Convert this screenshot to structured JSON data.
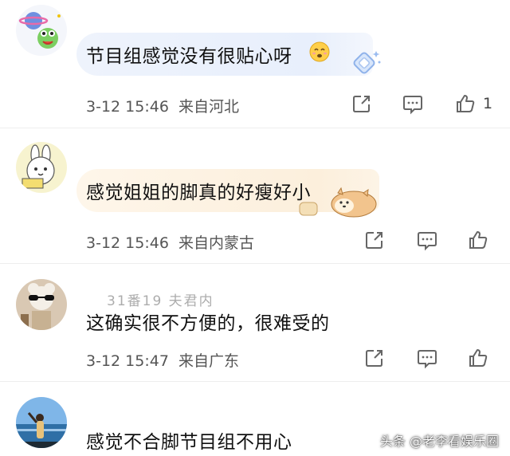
{
  "comments": [
    {
      "text": "节目组感觉没有很贴心呀",
      "time": "3-12 15:46",
      "location": "来自河北",
      "likes": "1"
    },
    {
      "text": "感觉姐姐的脚真的好瘦好小",
      "time": "3-12 15:46",
      "location": "来自内蒙古",
      "likes": ""
    },
    {
      "text": "这确实很不方便的，很难受的",
      "time": "3-12 15:47",
      "location": "来自广东",
      "likes": "",
      "faded_overlay": "31番19 夫君内"
    },
    {
      "text": "感觉不合脚节目组不用心"
    }
  ],
  "watermark": "头条 @老李看娱乐圈",
  "icons": [
    "share-icon",
    "comment-icon",
    "like-icon",
    "emoji-icon",
    "sticker-icon"
  ],
  "colors": {
    "bubble_blue": "#eaf1fd",
    "bubble_peach": "#fdf1df",
    "text": "#111111",
    "meta": "#555555"
  }
}
